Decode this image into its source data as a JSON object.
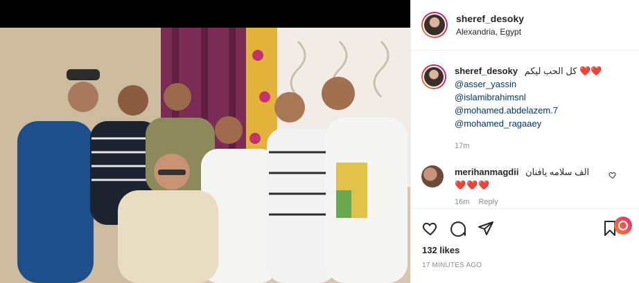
{
  "header": {
    "username": "sheref_desoky",
    "location": "Alexandria, Egypt"
  },
  "caption": {
    "username": "sheref_desoky",
    "text": "كل الحب ليكم",
    "hearts": "❤️❤️",
    "mentions": [
      "@asser_yassin",
      "@islamibrahimsnl",
      "@mohamed.abdelazem.7",
      "@mohamed_ragaaey"
    ],
    "time": "17m"
  },
  "comment": {
    "username": "merihanmagdii",
    "text": "الف سلامه يافنان",
    "hearts": "❤️❤️❤️",
    "time": "16m",
    "reply": "Reply"
  },
  "actions": {
    "likes": "132 likes",
    "posted": "17 MINUTES AGO"
  },
  "icons": [
    "heart-icon",
    "comment-icon",
    "share-icon",
    "bookmark-icon"
  ],
  "colors": {
    "accent": "#ed1c24",
    "link": "#00376b",
    "muted": "#8e8e8e"
  }
}
